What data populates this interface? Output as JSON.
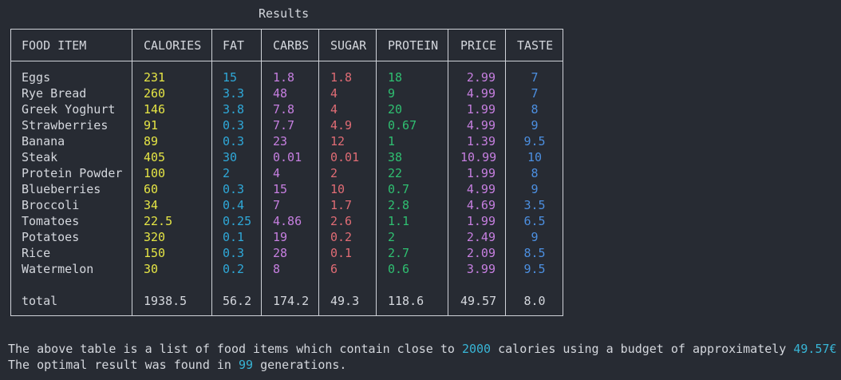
{
  "title": "Results",
  "colors": {
    "calories": "#e5e545",
    "fat": "#2fa8d8",
    "carbs": "#c67fe0",
    "sugar": "#e06c75",
    "protein": "#2fbf71",
    "price": "#c67fe0",
    "taste": "#4c8fe0",
    "text": "#d4d7dd",
    "highlight": "#38b5d6"
  },
  "table": {
    "headers": [
      "FOOD ITEM",
      "CALORIES",
      "FAT",
      "CARBS",
      "SUGAR",
      "PROTEIN",
      "PRICE",
      "TASTE"
    ],
    "rows": [
      [
        "Eggs",
        "231",
        "15",
        "1.8",
        "1.8",
        "18",
        "2.99",
        "7"
      ],
      [
        "Rye Bread",
        "260",
        "3.3",
        "48",
        "4",
        "9",
        "4.99",
        "7"
      ],
      [
        "Greek Yoghurt",
        "146",
        "3.8",
        "7.8",
        "4",
        "20",
        "1.99",
        "8"
      ],
      [
        "Strawberries",
        "91",
        "0.3",
        "7.7",
        "4.9",
        "0.67",
        "4.99",
        "9"
      ],
      [
        "Banana",
        "89",
        "0.3",
        "23",
        "12",
        "1",
        "1.39",
        "9.5"
      ],
      [
        "Steak",
        "405",
        "30",
        "0.01",
        "0.01",
        "38",
        "10.99",
        "10"
      ],
      [
        "Protein Powder",
        "100",
        "2",
        "4",
        "2",
        "22",
        "1.99",
        "8"
      ],
      [
        "Blueberries",
        "60",
        "0.3",
        "15",
        "10",
        "0.7",
        "4.99",
        "9"
      ],
      [
        "Broccoli",
        "34",
        "0.4",
        "7",
        "1.7",
        "2.8",
        "4.69",
        "3.5"
      ],
      [
        "Tomatoes",
        "22.5",
        "0.25",
        "4.86",
        "2.6",
        "1.1",
        "1.99",
        "6.5"
      ],
      [
        "Potatoes",
        "320",
        "0.1",
        "19",
        "0.2",
        "2",
        "2.49",
        "9"
      ],
      [
        "Rice",
        "150",
        "0.3",
        "28",
        "0.1",
        "2.7",
        "2.09",
        "8.5"
      ],
      [
        "Watermelon",
        "30",
        "0.2",
        "8",
        "6",
        "0.6",
        "3.99",
        "9.5"
      ]
    ],
    "totals": [
      "total",
      "1938.5",
      "56.2",
      "174.2",
      "49.3",
      "118.6",
      "49.57",
      "8.0"
    ]
  },
  "footer": {
    "line1_prefix": "The above table is a list of food items which contain close to ",
    "line1_calories": "2000",
    "line1_middle": " calories using a budget of approximately ",
    "line1_budget": "49.57€",
    "line2_prefix": "The optimal result was found in ",
    "line2_generations": "99",
    "line2_suffix": " generations."
  }
}
